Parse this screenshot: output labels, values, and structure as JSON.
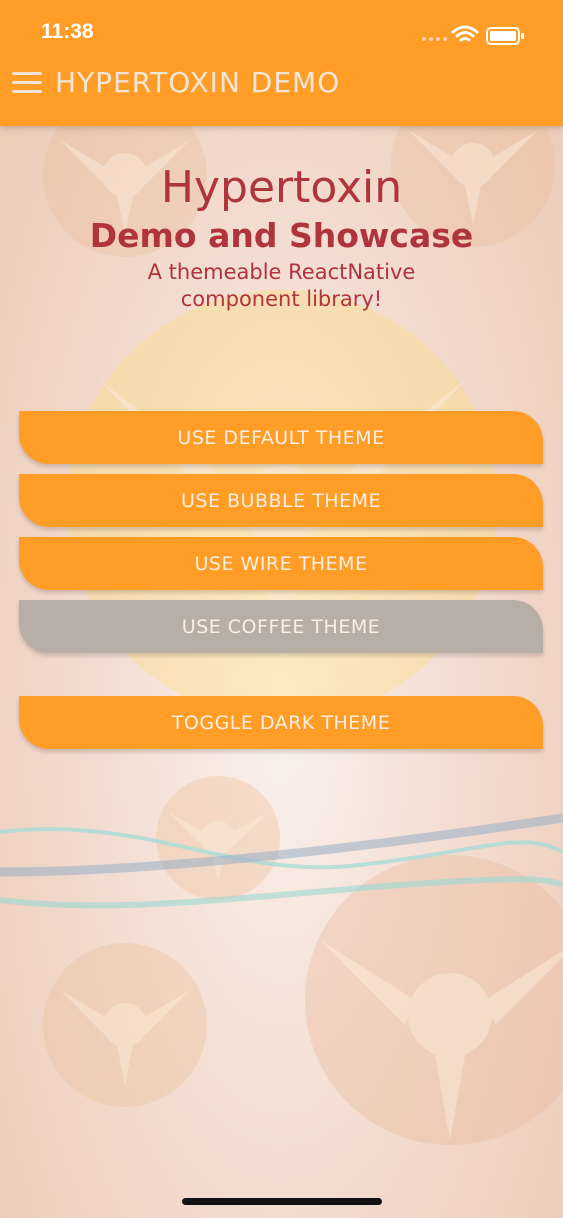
{
  "status_bar": {
    "time": "11:38"
  },
  "header": {
    "title": "HYPERTOXIN DEMO"
  },
  "hero": {
    "title": "Hypertoxin",
    "subtitle": "Demo and Showcase",
    "tagline_line1": "A themeable ReactNative",
    "tagline_line2": "component library!"
  },
  "buttons": [
    {
      "label": "USE DEFAULT THEME",
      "selected": false
    },
    {
      "label": "USE BUBBLE THEME",
      "selected": false
    },
    {
      "label": "USE WIRE THEME",
      "selected": false
    },
    {
      "label": "USE COFFEE THEME",
      "selected": true
    },
    {
      "label": "TOGGLE DARK THEME",
      "selected": false
    }
  ],
  "colors": {
    "accent": "#ff9d26",
    "title_text": "#b0343c",
    "selected_button": "#b9aea5",
    "button_text": "#fbeee2"
  }
}
